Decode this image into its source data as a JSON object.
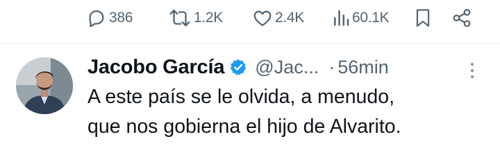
{
  "actions": {
    "replies": "386",
    "reposts": "1.2K",
    "likes": "2.4K",
    "views": "60.1K"
  },
  "tweet": {
    "author": {
      "display_name": "Jacobo García",
      "handle": "@Jac...",
      "verified": true
    },
    "separator": "·",
    "time": "56min",
    "text_lines": [
      "A este país se le olvida, a menudo,",
      "que nos gobierna el hijo de Alvarito."
    ]
  },
  "colors": {
    "secondary_text": "#536471",
    "primary_text": "#0f1419",
    "verified_badge": "#1d9bf0",
    "divider": "#eff3f4"
  },
  "icons": [
    "reply-icon",
    "repost-icon",
    "like-icon",
    "views-icon",
    "bookmark-icon",
    "share-icon",
    "verified-badge-icon",
    "more-options-icon"
  ]
}
